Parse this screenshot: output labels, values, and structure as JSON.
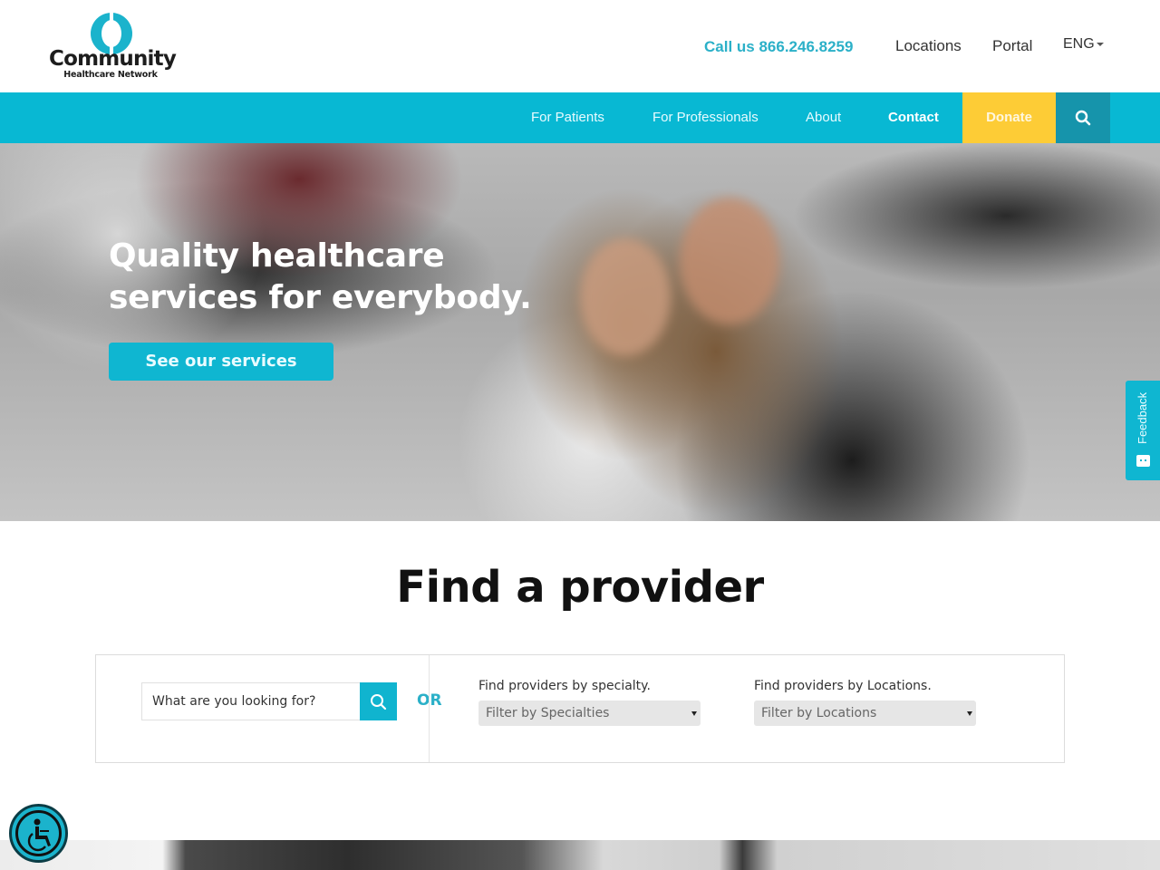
{
  "header": {
    "logo": {
      "title": "Community",
      "subtitle": "Healthcare Network"
    },
    "call_us": "Call us 866.246.8259",
    "util_links": [
      "Locations",
      "Portal"
    ],
    "language": "ENG"
  },
  "nav": {
    "items": [
      "For Patients",
      "For Professionals",
      "About",
      "Contact",
      "Donate"
    ],
    "search_icon": "search-icon"
  },
  "hero": {
    "title_line1": "Quality healthcare",
    "title_line2": "services for everybody.",
    "cta": "See our services"
  },
  "feedback": {
    "label": "Feedback"
  },
  "find_provider": {
    "title": "Find a provider",
    "search_placeholder": "What are you looking for?",
    "or_label": "OR",
    "specialty_label": "Find providers by specialty.",
    "specialty_select": "Filter by Specialties",
    "location_label": "Find providers by Locations.",
    "location_select": "Filter by Locations"
  },
  "colors": {
    "brand_teal": "#08b8d3",
    "donate_yellow": "#fdcc36",
    "search_dark_teal": "#1694ab",
    "call_text": "#2bb0c8"
  },
  "accessibility": {
    "icon": "wheelchair-icon"
  }
}
